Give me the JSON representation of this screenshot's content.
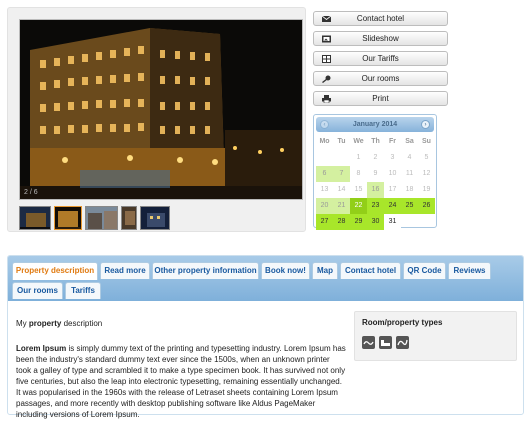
{
  "gallery": {
    "counter": "2 / 6",
    "thumbnails": [
      "hotel-night-front",
      "hotel-night-angle",
      "city-street",
      "interior-room",
      "hotel-dusk"
    ]
  },
  "side_buttons": [
    {
      "label": "Contact hotel",
      "icon": "envelope-icon"
    },
    {
      "label": "Slideshow",
      "icon": "slideshow-icon"
    },
    {
      "label": "Our Tariffs",
      "icon": "tariffs-icon"
    },
    {
      "label": "Our rooms",
      "icon": "key-icon"
    },
    {
      "label": "Print",
      "icon": "printer-icon"
    }
  ],
  "calendar": {
    "title": "January 2014",
    "weekdays": [
      "Mo",
      "Tu",
      "We",
      "Th",
      "Fr",
      "Sa",
      "Su"
    ],
    "weeks": [
      [
        {
          "d": "",
          "s": "empty"
        },
        {
          "d": "",
          "s": "empty"
        },
        {
          "d": "1",
          "s": "past"
        },
        {
          "d": "2",
          "s": "past"
        },
        {
          "d": "3",
          "s": "past"
        },
        {
          "d": "4",
          "s": "past"
        },
        {
          "d": "5",
          "s": "past"
        }
      ],
      [
        {
          "d": "6",
          "s": "light"
        },
        {
          "d": "7",
          "s": "light"
        },
        {
          "d": "8",
          "s": "past"
        },
        {
          "d": "9",
          "s": "past"
        },
        {
          "d": "10",
          "s": "past"
        },
        {
          "d": "11",
          "s": "past"
        },
        {
          "d": "12",
          "s": "past"
        }
      ],
      [
        {
          "d": "13",
          "s": "past"
        },
        {
          "d": "14",
          "s": "past"
        },
        {
          "d": "15",
          "s": "past"
        },
        {
          "d": "16",
          "s": "light"
        },
        {
          "d": "17",
          "s": "past"
        },
        {
          "d": "18",
          "s": "past"
        },
        {
          "d": "19",
          "s": "past"
        }
      ],
      [
        {
          "d": "20",
          "s": "light"
        },
        {
          "d": "21",
          "s": "light"
        },
        {
          "d": "22",
          "s": "today"
        },
        {
          "d": "23",
          "s": "bright"
        },
        {
          "d": "24",
          "s": "bright"
        },
        {
          "d": "25",
          "s": "bright"
        },
        {
          "d": "26",
          "s": "bright"
        }
      ],
      [
        {
          "d": "27",
          "s": "bright"
        },
        {
          "d": "28",
          "s": "bright"
        },
        {
          "d": "29",
          "s": "bright"
        },
        {
          "d": "30",
          "s": "bright"
        },
        {
          "d": "31",
          "s": "normal"
        },
        {
          "d": "",
          "s": "empty"
        },
        {
          "d": "",
          "s": "empty"
        }
      ]
    ]
  },
  "tabs": {
    "row1": [
      "Property description",
      "Read more",
      "Other property information",
      "Book now!",
      "Map",
      "Contact hotel",
      "QR Code",
      "Reviews"
    ],
    "row2": [
      "Our rooms",
      "Tariffs"
    ],
    "active": "Property description"
  },
  "description": {
    "intro_prefix": "My ",
    "intro_bold": "property",
    "intro_suffix": " description",
    "lorem_bold": "Lorem Ipsum",
    "body": " is simply dummy text of the printing and typesetting industry. Lorem Ipsum has been the industry's standard dummy text ever since the 1500s, when an unknown printer took a galley of type and scrambled it to make a type specimen book. It has survived not only five centuries, but also the leap into electronic typesetting, remaining essentially unchanged. It was popularised in the 1960s with the release of Letraset sheets containing Lorem Ipsum passages, and more recently with desktop publishing software like Aldus PageMaker including versions of Lorem Ipsum."
  },
  "room_types": {
    "title": "Room/property types",
    "icons": [
      "room-type-1-icon",
      "room-type-2-icon",
      "room-type-3-icon"
    ]
  },
  "colors": {
    "accent_orange": "#e07a10",
    "tab_blue": "#1a5aa0",
    "calendar_green": "#a8e62a",
    "calendar_light_green": "#d4f0a0"
  }
}
